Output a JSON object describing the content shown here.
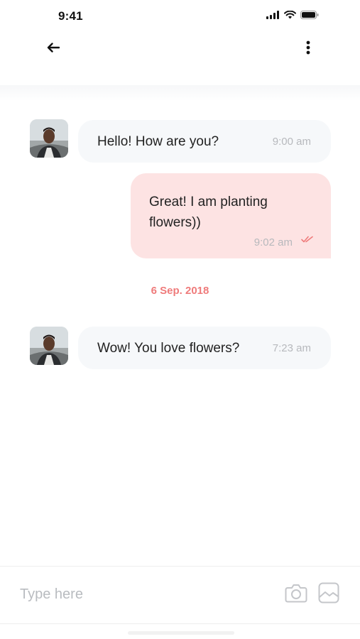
{
  "status_bar": {
    "time": "9:41",
    "icons": [
      "signal-icon",
      "wifi-icon",
      "battery-icon"
    ]
  },
  "header": {
    "back_icon": "arrow-left-icon",
    "more_icon": "more-vertical-icon"
  },
  "messages": [
    {
      "direction": "incoming",
      "text": "Hello! How are you?",
      "time": "9:00 am"
    },
    {
      "direction": "outgoing",
      "text": "Great! I am planting flowers))",
      "time": "9:02 am",
      "status_icon": "double-check-icon"
    },
    {
      "direction": "incoming",
      "text": "Wow! You love flowers?",
      "time": "7:23 am"
    }
  ],
  "date_divider": "6 Sep. 2018",
  "composer": {
    "placeholder": "Type here",
    "camera_icon": "camera-icon",
    "gallery_icon": "image-icon"
  },
  "colors": {
    "accent": "#ef7b7b",
    "incoming_bubble": "#f6f8fa",
    "outgoing_bubble": "#fde3e3",
    "timestamp": "#b7b9bd"
  }
}
